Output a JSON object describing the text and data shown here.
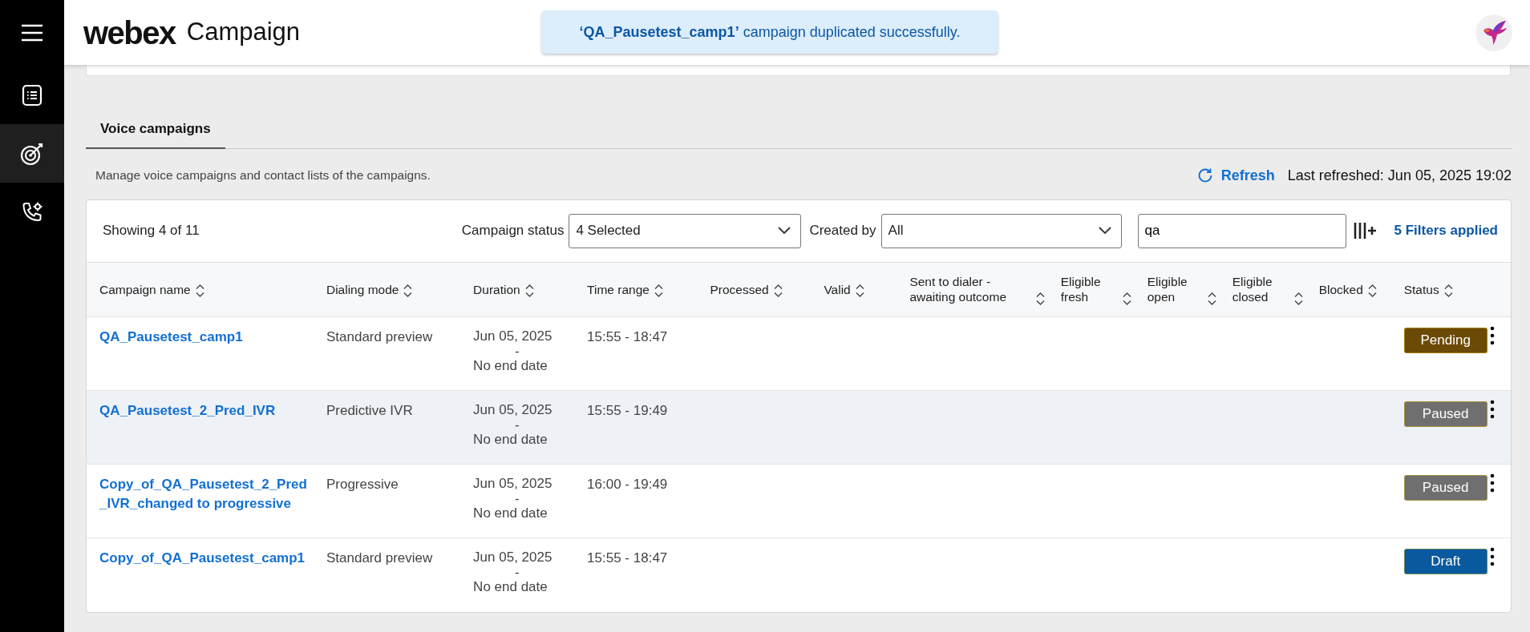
{
  "sidebar": {
    "items": [
      {
        "kind": "menu",
        "selected": false
      },
      {
        "kind": "list",
        "selected": false
      },
      {
        "kind": "target",
        "selected": true
      },
      {
        "kind": "phone",
        "selected": false
      }
    ]
  },
  "header": {
    "logo": "webex",
    "app_name": "Campaign"
  },
  "toast": {
    "message": "**‘QA_Pausetest_camp1’** campaign duplicated successfully."
  },
  "tabs": [
    {
      "label": "Voice campaigns",
      "selected": true
    }
  ],
  "description": "Manage voice campaigns and contact lists of the campaigns.",
  "refresh": {
    "label": "Refresh",
    "last_refreshed": "Last refreshed: Jun 05, 2025 19:02"
  },
  "filters": {
    "showing": "Showing 4 of 11",
    "campaign_status": {
      "label": "Campaign status",
      "value": "4 Selected"
    },
    "created_by": {
      "label": "Created by",
      "value": "All"
    },
    "search": {
      "value": "qa"
    },
    "applied": "5 Filters applied"
  },
  "table": {
    "columns": [
      {
        "label": "Campaign name"
      },
      {
        "label": "Dialing mode"
      },
      {
        "label": "Duration"
      },
      {
        "label": "Time range"
      },
      {
        "label": "Processed"
      },
      {
        "label": "Valid"
      },
      {
        "label": "Sent to dialer - awaiting outcome"
      },
      {
        "label": "Eligible fresh"
      },
      {
        "label": "Eligible open"
      },
      {
        "label": "Eligible closed"
      },
      {
        "label": "Blocked"
      },
      {
        "label": "Status"
      }
    ],
    "rows": [
      {
        "name": "QA_Pausetest_camp1",
        "dialing_mode": "Standard preview",
        "duration": [
          "Jun 05, 2025",
          "-",
          "No end date"
        ],
        "time_range": "15:55 - 18:47",
        "status": {
          "label": "Pending",
          "color": "#6b4a06"
        },
        "hovered": false
      },
      {
        "name": "QA_Pausetest_2_Pred_IVR",
        "dialing_mode": "Predictive IVR",
        "duration": [
          "Jun 05, 2025",
          "-",
          "No end date"
        ],
        "time_range": "15:55 - 19:49",
        "status": {
          "label": "Paused",
          "color": "#6f6f6f"
        },
        "hovered": true
      },
      {
        "name": "Copy_of_QA_Pausetest_2_Pred_IVR_changed to progressive",
        "dialing_mode": "Progressive",
        "duration": [
          "Jun 05, 2025",
          "-",
          "No end date"
        ],
        "time_range": "16:00 - 19:49",
        "status": {
          "label": "Paused",
          "color": "#6f6f6f"
        },
        "hovered": false
      },
      {
        "name": "Copy_of_QA_Pausetest_camp1",
        "dialing_mode": "Standard preview",
        "duration": [
          "Jun 05, 2025",
          "-",
          "No end date"
        ],
        "time_range": "15:55 - 18:47",
        "status": {
          "label": "Draft",
          "color": "#08599e"
        },
        "hovered": false
      }
    ]
  }
}
